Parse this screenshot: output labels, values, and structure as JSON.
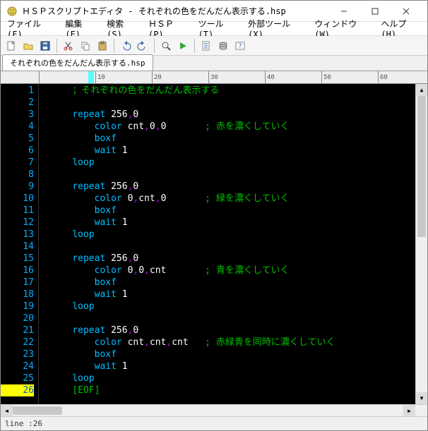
{
  "window": {
    "title": "ＨＳＰスクリプトエディタ - それぞれの色をだんだん表示する.hsp"
  },
  "menu": {
    "file": "ファイル(F)",
    "edit": "編集(E)",
    "search": "検索(S)",
    "hsp": "ＨＳＰ(P)",
    "tools": "ツール(T)",
    "exttools": "外部ツール(X)",
    "window_m": "ウィンドウ(W)",
    "help": "ヘルプ(H)"
  },
  "tab": {
    "name": "それぞれの色をだんだん表示する.hsp"
  },
  "ruler": {
    "marks": [
      "",
      "10",
      "20",
      "30",
      "40",
      "50",
      "60"
    ]
  },
  "code_lines": [
    {
      "n": 1,
      "tokens": [
        {
          "cls": "sp",
          "t": "    "
        },
        {
          "cls": "tok-comment",
          "t": "；それぞれの色をだんだん表示する"
        }
      ]
    },
    {
      "n": 2,
      "tokens": []
    },
    {
      "n": 3,
      "tokens": [
        {
          "cls": "sp",
          "t": "    "
        },
        {
          "cls": "tok-kw",
          "t": "repeat"
        },
        {
          "cls": "",
          "t": " "
        },
        {
          "cls": "tok-num",
          "t": "256"
        },
        {
          "cls": "tok-op",
          "t": ","
        },
        {
          "cls": "tok-num",
          "t": "0"
        }
      ]
    },
    {
      "n": 4,
      "tokens": [
        {
          "cls": "sp",
          "t": "        "
        },
        {
          "cls": "tok-kw",
          "t": "color"
        },
        {
          "cls": "",
          "t": " "
        },
        {
          "cls": "tok-num",
          "t": "cnt"
        },
        {
          "cls": "tok-op",
          "t": ","
        },
        {
          "cls": "tok-num",
          "t": "0"
        },
        {
          "cls": "tok-op",
          "t": ","
        },
        {
          "cls": "tok-num",
          "t": "0"
        },
        {
          "cls": "",
          "t": "       "
        },
        {
          "cls": "tok-comment",
          "t": "; 赤を濃くしていく"
        }
      ]
    },
    {
      "n": 5,
      "tokens": [
        {
          "cls": "sp",
          "t": "        "
        },
        {
          "cls": "tok-kw",
          "t": "boxf"
        }
      ]
    },
    {
      "n": 6,
      "tokens": [
        {
          "cls": "sp",
          "t": "        "
        },
        {
          "cls": "tok-kw",
          "t": "wait"
        },
        {
          "cls": "",
          "t": " "
        },
        {
          "cls": "tok-num",
          "t": "1"
        }
      ]
    },
    {
      "n": 7,
      "tokens": [
        {
          "cls": "sp",
          "t": "    "
        },
        {
          "cls": "tok-kw",
          "t": "loop"
        }
      ]
    },
    {
      "n": 8,
      "tokens": []
    },
    {
      "n": 9,
      "tokens": [
        {
          "cls": "sp",
          "t": "    "
        },
        {
          "cls": "tok-kw",
          "t": "repeat"
        },
        {
          "cls": "",
          "t": " "
        },
        {
          "cls": "tok-num",
          "t": "256"
        },
        {
          "cls": "tok-op",
          "t": ","
        },
        {
          "cls": "tok-num",
          "t": "0"
        }
      ]
    },
    {
      "n": 10,
      "tokens": [
        {
          "cls": "sp",
          "t": "        "
        },
        {
          "cls": "tok-kw",
          "t": "color"
        },
        {
          "cls": "",
          "t": " "
        },
        {
          "cls": "tok-num",
          "t": "0"
        },
        {
          "cls": "tok-op",
          "t": ","
        },
        {
          "cls": "tok-num",
          "t": "cnt"
        },
        {
          "cls": "tok-op",
          "t": ","
        },
        {
          "cls": "tok-num",
          "t": "0"
        },
        {
          "cls": "",
          "t": "       "
        },
        {
          "cls": "tok-comment",
          "t": "; 緑を濃くしていく"
        }
      ]
    },
    {
      "n": 11,
      "tokens": [
        {
          "cls": "sp",
          "t": "        "
        },
        {
          "cls": "tok-kw",
          "t": "boxf"
        }
      ]
    },
    {
      "n": 12,
      "tokens": [
        {
          "cls": "sp",
          "t": "        "
        },
        {
          "cls": "tok-kw",
          "t": "wait"
        },
        {
          "cls": "",
          "t": " "
        },
        {
          "cls": "tok-num",
          "t": "1"
        }
      ]
    },
    {
      "n": 13,
      "tokens": [
        {
          "cls": "sp",
          "t": "    "
        },
        {
          "cls": "tok-kw",
          "t": "loop"
        }
      ]
    },
    {
      "n": 14,
      "tokens": []
    },
    {
      "n": 15,
      "tokens": [
        {
          "cls": "sp",
          "t": "    "
        },
        {
          "cls": "tok-kw",
          "t": "repeat"
        },
        {
          "cls": "",
          "t": " "
        },
        {
          "cls": "tok-num",
          "t": "256"
        },
        {
          "cls": "tok-op",
          "t": ","
        },
        {
          "cls": "tok-num",
          "t": "0"
        }
      ]
    },
    {
      "n": 16,
      "tokens": [
        {
          "cls": "sp",
          "t": "        "
        },
        {
          "cls": "tok-kw",
          "t": "color"
        },
        {
          "cls": "",
          "t": " "
        },
        {
          "cls": "tok-num",
          "t": "0"
        },
        {
          "cls": "tok-op",
          "t": ","
        },
        {
          "cls": "tok-num",
          "t": "0"
        },
        {
          "cls": "tok-op",
          "t": ","
        },
        {
          "cls": "tok-num",
          "t": "cnt"
        },
        {
          "cls": "",
          "t": "       "
        },
        {
          "cls": "tok-comment",
          "t": "; 青を濃くしていく"
        }
      ]
    },
    {
      "n": 17,
      "tokens": [
        {
          "cls": "sp",
          "t": "        "
        },
        {
          "cls": "tok-kw",
          "t": "boxf"
        }
      ]
    },
    {
      "n": 18,
      "tokens": [
        {
          "cls": "sp",
          "t": "        "
        },
        {
          "cls": "tok-kw",
          "t": "wait"
        },
        {
          "cls": "",
          "t": " "
        },
        {
          "cls": "tok-num",
          "t": "1"
        }
      ]
    },
    {
      "n": 19,
      "tokens": [
        {
          "cls": "sp",
          "t": "    "
        },
        {
          "cls": "tok-kw",
          "t": "loop"
        }
      ]
    },
    {
      "n": 20,
      "tokens": []
    },
    {
      "n": 21,
      "tokens": [
        {
          "cls": "sp",
          "t": "    "
        },
        {
          "cls": "tok-kw",
          "t": "repeat"
        },
        {
          "cls": "",
          "t": " "
        },
        {
          "cls": "tok-num",
          "t": "256"
        },
        {
          "cls": "tok-op",
          "t": ","
        },
        {
          "cls": "tok-num",
          "t": "0"
        }
      ]
    },
    {
      "n": 22,
      "tokens": [
        {
          "cls": "sp",
          "t": "        "
        },
        {
          "cls": "tok-kw",
          "t": "color"
        },
        {
          "cls": "",
          "t": " "
        },
        {
          "cls": "tok-num",
          "t": "cnt"
        },
        {
          "cls": "tok-op",
          "t": ","
        },
        {
          "cls": "tok-num",
          "t": "cnt"
        },
        {
          "cls": "tok-op",
          "t": ","
        },
        {
          "cls": "tok-num",
          "t": "cnt"
        },
        {
          "cls": "",
          "t": "   "
        },
        {
          "cls": "tok-comment",
          "t": "; 赤緑青を同時に濃くしていく"
        }
      ]
    },
    {
      "n": 23,
      "tokens": [
        {
          "cls": "sp",
          "t": "        "
        },
        {
          "cls": "tok-kw",
          "t": "boxf"
        }
      ]
    },
    {
      "n": 24,
      "tokens": [
        {
          "cls": "sp",
          "t": "        "
        },
        {
          "cls": "tok-kw",
          "t": "wait"
        },
        {
          "cls": "",
          "t": " "
        },
        {
          "cls": "tok-num",
          "t": "1"
        }
      ]
    },
    {
      "n": 25,
      "tokens": [
        {
          "cls": "sp",
          "t": "    "
        },
        {
          "cls": "tok-kw",
          "t": "loop"
        }
      ]
    },
    {
      "n": 26,
      "tokens": [
        {
          "cls": "sp",
          "t": "    "
        },
        {
          "cls": "tok-eof",
          "t": "[EOF]"
        }
      ],
      "current": true
    }
  ],
  "status": {
    "line_label": "line : ",
    "line_no": "26"
  }
}
